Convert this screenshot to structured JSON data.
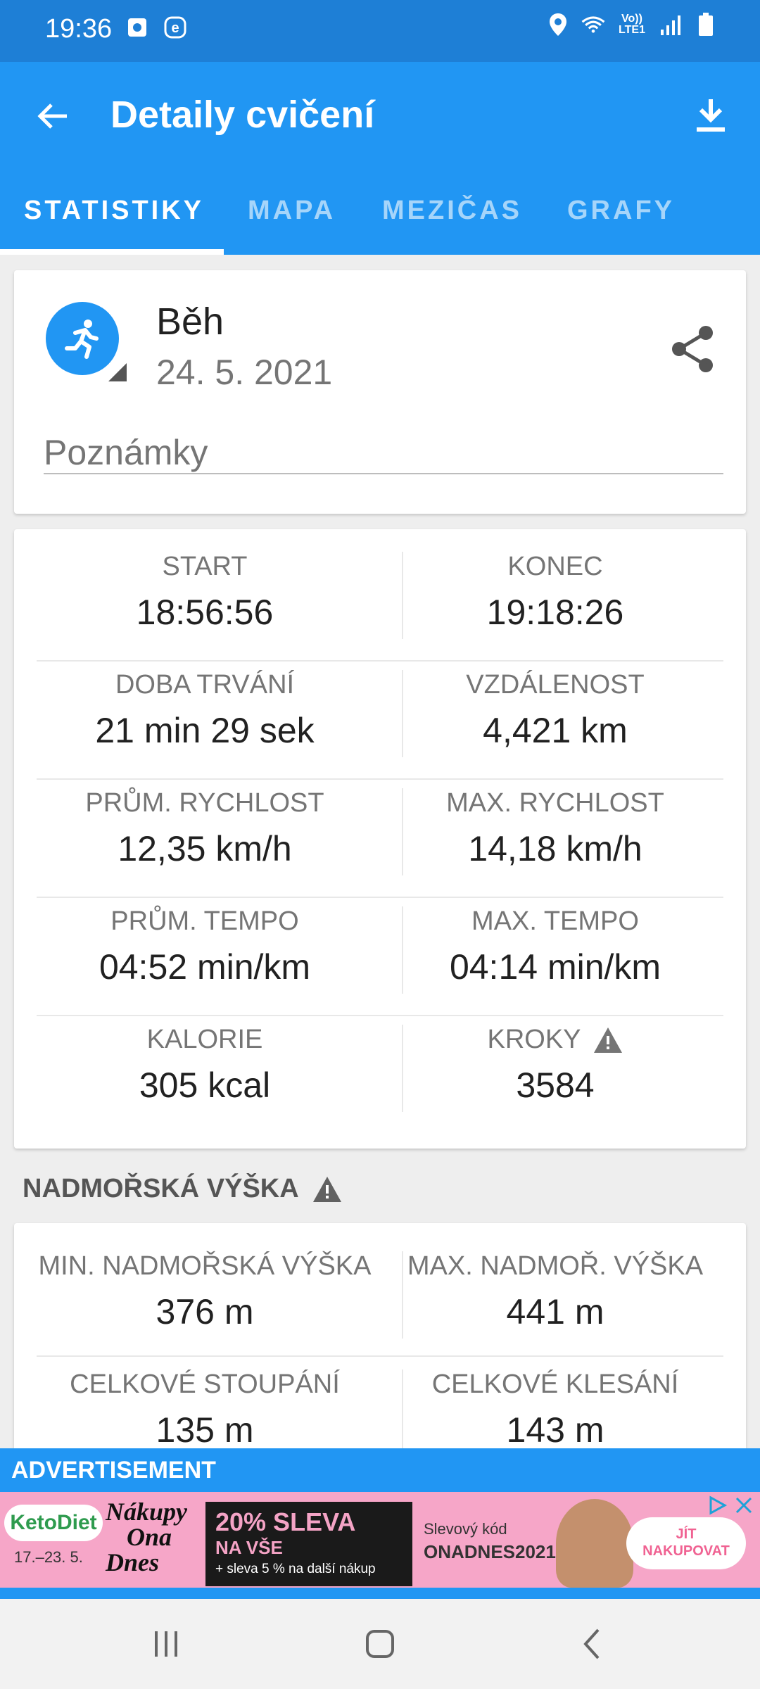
{
  "status_bar": {
    "time": "19:36",
    "network_label": "Vo)) LTE1"
  },
  "app_bar": {
    "title": "Detaily cvičení"
  },
  "tabs": [
    {
      "label": "STATISTIKY"
    },
    {
      "label": "MAPA"
    },
    {
      "label": "MEZIČAS"
    },
    {
      "label": "GRAFY"
    }
  ],
  "activity": {
    "name": "Běh",
    "date": "24. 5. 2021",
    "notes_placeholder": "Poznámky"
  },
  "stats": [
    [
      {
        "label": "START",
        "value": "18:56:56"
      },
      {
        "label": "KONEC",
        "value": "19:18:26"
      }
    ],
    [
      {
        "label": "DOBA TRVÁNÍ",
        "value": "21 min 29 sek"
      },
      {
        "label": "VZDÁLENOST",
        "value": "4,421 km"
      }
    ],
    [
      {
        "label": "PRŮM. RYCHLOST",
        "value": "12,35 km/h"
      },
      {
        "label": "MAX. RYCHLOST",
        "value": "14,18 km/h"
      }
    ],
    [
      {
        "label": "PRŮM. TEMPO",
        "value": "04:52 min/km"
      },
      {
        "label": "MAX. TEMPO",
        "value": "04:14 min/km"
      }
    ],
    [
      {
        "label": "KALORIE",
        "value": "305 kcal"
      },
      {
        "label": "KROKY",
        "value": "3584"
      }
    ]
  ],
  "elevation": {
    "title": "NADMOŘSKÁ VÝŠKA",
    "rows": [
      [
        {
          "label": "MIN. NADMOŘSKÁ VÝŠKA",
          "value": "376 m"
        },
        {
          "label": "MAX. NADMOŘ. VÝŠKA",
          "value": "441 m"
        }
      ],
      [
        {
          "label": "CELKOVÉ STOUPÁNÍ",
          "value": "135 m"
        },
        {
          "label": "CELKOVÉ KLESÁNÍ",
          "value": "143 m"
        }
      ]
    ]
  },
  "ad": {
    "header": "ADVERTISEMENT",
    "keto": "KetoDiet",
    "keto_dates": "17.–23. 5.",
    "brand_line1": "Nákupy",
    "brand_line2": "Ona",
    "brand_line3": "Dnes",
    "promo_main": "20% SLEVA",
    "promo_sub": "NA VŠE",
    "promo_extra": "+ sleva 5 % na další nákup",
    "code_label": "Slevový kód",
    "code": "ONADNES2021",
    "cta_line1": "JÍT",
    "cta_line2": "NAKUPOVAT"
  },
  "colors": {
    "primary": "#2196f3",
    "status_bar": "#1e7fd6",
    "warning_icon": "#757575"
  }
}
